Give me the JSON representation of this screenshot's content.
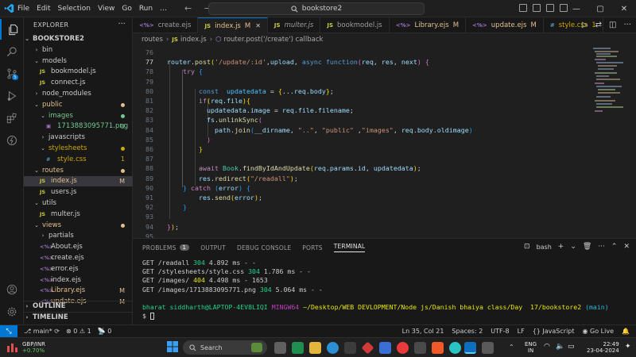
{
  "titlebar": {
    "menu": [
      "File",
      "Edit",
      "Selection",
      "View",
      "Go",
      "Run",
      "…"
    ],
    "nav_arrows": "← →",
    "search_text": "bookstore2"
  },
  "explorer": {
    "title": "EXPLORER",
    "project": "BOOKSTORE2",
    "items": [
      {
        "label": "bin",
        "type": "folder",
        "open": false,
        "indent": 1
      },
      {
        "label": "models",
        "type": "folder",
        "open": true,
        "indent": 1
      },
      {
        "label": "bookmodel.js",
        "type": "js",
        "indent": 2
      },
      {
        "label": "connect.js",
        "type": "js",
        "indent": 2
      },
      {
        "label": "node_modules",
        "type": "folder",
        "open": false,
        "indent": 1
      },
      {
        "label": "public",
        "type": "folder",
        "open": true,
        "indent": 1,
        "color": "#e2c08d",
        "dot": "#e2c08d"
      },
      {
        "label": "images",
        "type": "folder",
        "open": true,
        "indent": 2,
        "color": "#73c991",
        "dot": "#73c991"
      },
      {
        "label": "1713883095771.png",
        "type": "png",
        "indent": 3,
        "color": "#73c991",
        "badge": "U",
        "badge_color": "#73c991"
      },
      {
        "label": "javascripts",
        "type": "folder",
        "open": false,
        "indent": 2
      },
      {
        "label": "stylesheets",
        "type": "folder",
        "open": true,
        "indent": 2,
        "color": "#cca700",
        "dot": "#cca700"
      },
      {
        "label": "style.css",
        "type": "css",
        "indent": 3,
        "color": "#cca700",
        "badge": "1",
        "badge_color": "#cca700"
      },
      {
        "label": "routes",
        "type": "folder",
        "open": true,
        "indent": 1,
        "color": "#e2c08d",
        "dot": "#e2c08d"
      },
      {
        "label": "index.js",
        "type": "js",
        "indent": 2,
        "color": "#e2c08d",
        "badge": "M",
        "badge_color": "#e2c08d",
        "selected": true
      },
      {
        "label": "users.js",
        "type": "js",
        "indent": 2
      },
      {
        "label": "utils",
        "type": "folder",
        "open": true,
        "indent": 1
      },
      {
        "label": "multer.js",
        "type": "js",
        "indent": 2
      },
      {
        "label": "views",
        "type": "folder",
        "open": true,
        "indent": 1,
        "color": "#e2c08d",
        "dot": "#e2c08d"
      },
      {
        "label": "partials",
        "type": "folder",
        "open": false,
        "indent": 2
      },
      {
        "label": "About.ejs",
        "type": "ejs",
        "indent": 2
      },
      {
        "label": "create.ejs",
        "type": "ejs",
        "indent": 2
      },
      {
        "label": "error.ejs",
        "type": "ejs",
        "indent": 2
      },
      {
        "label": "index.ejs",
        "type": "ejs",
        "indent": 2
      },
      {
        "label": "Library.ejs",
        "type": "ejs",
        "indent": 2,
        "color": "#e2c08d",
        "badge": "M",
        "badge_color": "#e2c08d"
      },
      {
        "label": "update.ejs",
        "type": "ejs",
        "indent": 2,
        "color": "#e2c08d",
        "badge": "M",
        "badge_color": "#e2c08d"
      }
    ],
    "outline": "OUTLINE",
    "timeline": "TIMELINE"
  },
  "tabs": [
    {
      "label": "create.ejs",
      "icon": "ejs",
      "active": false,
      "italic": false
    },
    {
      "label": "index.js",
      "suffix": "M",
      "icon": "js",
      "active": true,
      "italic": false,
      "color": "#e2c08d"
    },
    {
      "label": "multer.js",
      "icon": "js",
      "active": false,
      "italic": true
    },
    {
      "label": "bookmodel.js",
      "icon": "js",
      "active": false,
      "italic": false
    },
    {
      "label": "Library.ejs",
      "suffix": "M",
      "icon": "ejs",
      "active": false,
      "italic": false,
      "color": "#e2c08d"
    },
    {
      "label": "update.ejs",
      "suffix": "M",
      "icon": "ejs",
      "active": false,
      "italic": false,
      "color": "#e2c08d"
    },
    {
      "label": "style.css",
      "suffix": "1",
      "icon": "css",
      "active": false,
      "italic": false,
      "color": "#cca700"
    }
  ],
  "breadcrumb": [
    "routes",
    "index.js",
    "router.post('/create') callback"
  ],
  "code_lines": [
    {
      "num": "76",
      "tokens": [
        [
          "",
          ""
        ]
      ]
    },
    {
      "num": "77",
      "tokens": [
        [
          "var",
          "router"
        ],
        [
          "def",
          "."
        ],
        [
          "fn",
          "post"
        ],
        [
          "br1",
          "("
        ],
        [
          "str",
          "'/update/:id'"
        ],
        [
          "def",
          ","
        ],
        [
          "var",
          "upload"
        ],
        [
          "def",
          ", "
        ],
        [
          "kw",
          "async"
        ],
        [
          "def",
          " "
        ],
        [
          "kw",
          "function"
        ],
        [
          "br2",
          "("
        ],
        [
          "var",
          "req"
        ],
        [
          "def",
          ", "
        ],
        [
          "var",
          "res"
        ],
        [
          "def",
          ", "
        ],
        [
          "var",
          "next"
        ],
        [
          "br2",
          ")"
        ],
        [
          "def",
          " "
        ],
        [
          "br2",
          "{"
        ]
      ]
    },
    {
      "num": "78",
      "tokens": [
        [
          "def",
          "    "
        ],
        [
          "ctl",
          "try"
        ],
        [
          "def",
          " "
        ],
        [
          "br3",
          "{"
        ]
      ]
    },
    {
      "num": "79",
      "tokens": [
        [
          "",
          ""
        ]
      ]
    },
    {
      "num": "80",
      "tokens": [
        [
          "def",
          "        "
        ],
        [
          "kw",
          "const"
        ],
        [
          "def",
          "  "
        ],
        [
          "const",
          "updatedata"
        ],
        [
          "def",
          " = "
        ],
        [
          "br1",
          "{"
        ],
        [
          "def",
          "..."
        ],
        [
          "var",
          "req"
        ],
        [
          "def",
          "."
        ],
        [
          "var",
          "body"
        ],
        [
          "br1",
          "}"
        ],
        [
          "def",
          ";"
        ]
      ]
    },
    {
      "num": "81",
      "tokens": [
        [
          "def",
          "        "
        ],
        [
          "ctl",
          "if"
        ],
        [
          "br1",
          "("
        ],
        [
          "var",
          "req"
        ],
        [
          "def",
          "."
        ],
        [
          "var",
          "file"
        ],
        [
          "br1",
          ")"
        ],
        [
          "br1",
          "{"
        ]
      ]
    },
    {
      "num": "82",
      "tokens": [
        [
          "def",
          "          "
        ],
        [
          "var",
          "updatedata"
        ],
        [
          "def",
          "."
        ],
        [
          "var",
          "image"
        ],
        [
          "def",
          " = "
        ],
        [
          "var",
          "req"
        ],
        [
          "def",
          "."
        ],
        [
          "var",
          "file"
        ],
        [
          "def",
          "."
        ],
        [
          "var",
          "filename"
        ],
        [
          "def",
          ";"
        ]
      ]
    },
    {
      "num": "83",
      "tokens": [
        [
          "def",
          "          "
        ],
        [
          "var",
          "fs"
        ],
        [
          "def",
          "."
        ],
        [
          "fn",
          "unlinkSync"
        ],
        [
          "br2",
          "("
        ]
      ]
    },
    {
      "num": "84",
      "tokens": [
        [
          "def",
          "            "
        ],
        [
          "var",
          "path"
        ],
        [
          "def",
          "."
        ],
        [
          "fn",
          "join"
        ],
        [
          "br3",
          "("
        ],
        [
          "var",
          "__dirname"
        ],
        [
          "def",
          ", "
        ],
        [
          "str",
          "\"..\""
        ],
        [
          "def",
          ", "
        ],
        [
          "str",
          "\"public\""
        ],
        [
          "def",
          " ,"
        ],
        [
          "str",
          "\"images\""
        ],
        [
          "def",
          ", "
        ],
        [
          "var",
          "req"
        ],
        [
          "def",
          "."
        ],
        [
          "var",
          "body"
        ],
        [
          "def",
          "."
        ],
        [
          "var",
          "oldimage"
        ],
        [
          "br3",
          ")"
        ]
      ]
    },
    {
      "num": "85",
      "tokens": [
        [
          "def",
          "          "
        ],
        [
          "br2",
          ")"
        ]
      ]
    },
    {
      "num": "86",
      "tokens": [
        [
          "def",
          "        "
        ],
        [
          "br1",
          "}"
        ]
      ]
    },
    {
      "num": "87",
      "tokens": [
        [
          "",
          ""
        ]
      ]
    },
    {
      "num": "88",
      "tokens": [
        [
          "def",
          "        "
        ],
        [
          "ctl",
          "await"
        ],
        [
          "def",
          " "
        ],
        [
          "cls",
          "Book"
        ],
        [
          "def",
          "."
        ],
        [
          "fn",
          "findByIdAndUpdate"
        ],
        [
          "br1",
          "("
        ],
        [
          "var",
          "req"
        ],
        [
          "def",
          "."
        ],
        [
          "var",
          "params"
        ],
        [
          "def",
          "."
        ],
        [
          "var",
          "id"
        ],
        [
          "def",
          ", "
        ],
        [
          "var",
          "updatedata"
        ],
        [
          "br1",
          ")"
        ],
        [
          "def",
          ";"
        ]
      ]
    },
    {
      "num": "89",
      "tokens": [
        [
          "def",
          "        "
        ],
        [
          "var",
          "res"
        ],
        [
          "def",
          "."
        ],
        [
          "fn",
          "redirect"
        ],
        [
          "br1",
          "("
        ],
        [
          "str",
          "\"/readall\""
        ],
        [
          "br1",
          ")"
        ],
        [
          "def",
          ";"
        ]
      ]
    },
    {
      "num": "90",
      "tokens": [
        [
          "def",
          "    "
        ],
        [
          "br3",
          "}"
        ],
        [
          "def",
          " "
        ],
        [
          "ctl",
          "catch"
        ],
        [
          "def",
          " "
        ],
        [
          "br3",
          "("
        ],
        [
          "var",
          "error"
        ],
        [
          "br3",
          ")"
        ],
        [
          "def",
          " "
        ],
        [
          "br3",
          "{"
        ]
      ]
    },
    {
      "num": "91",
      "tokens": [
        [
          "def",
          "        "
        ],
        [
          "var",
          "res"
        ],
        [
          "def",
          "."
        ],
        [
          "fn",
          "send"
        ],
        [
          "br1",
          "("
        ],
        [
          "var",
          "error"
        ],
        [
          "br1",
          ")"
        ],
        [
          "def",
          ";"
        ]
      ]
    },
    {
      "num": "92",
      "tokens": [
        [
          "def",
          "    "
        ],
        [
          "br3",
          "}"
        ]
      ]
    },
    {
      "num": "93",
      "tokens": [
        [
          "",
          ""
        ]
      ]
    },
    {
      "num": "94",
      "tokens": [
        [
          "br2",
          "}"
        ],
        [
          "br1",
          ")"
        ],
        [
          "def",
          ";"
        ]
      ]
    },
    {
      "num": "95",
      "tokens": [
        [
          "",
          ""
        ]
      ]
    }
  ],
  "panel": {
    "tabs": [
      {
        "label": "PROBLEMS",
        "count": "1"
      },
      {
        "label": "OUTPUT"
      },
      {
        "label": "DEBUG CONSOLE"
      },
      {
        "label": "PORTS"
      },
      {
        "label": "TERMINAL",
        "active": true
      }
    ],
    "shell": "bash",
    "terminal_lines": [
      [
        [
          "def",
          "GET /readall "
        ],
        [
          "grn",
          "304"
        ],
        [
          "def",
          " 4.892 ms - -"
        ]
      ],
      [
        [
          "def",
          "GET /stylesheets/style.css "
        ],
        [
          "grn",
          "304"
        ],
        [
          "def",
          " 1.786 ms - -"
        ]
      ],
      [
        [
          "def",
          "GET /images/ "
        ],
        [
          "ylw",
          "404"
        ],
        [
          "def",
          " 4.498 ms - 1653"
        ]
      ],
      [
        [
          "def",
          "GET /images/1713883095771.png "
        ],
        [
          "grn",
          "304"
        ],
        [
          "def",
          " 5.064 ms - -"
        ]
      ],
      [
        [
          "",
          ""
        ]
      ],
      [
        [
          "grn",
          "bharat siddharth@LAPTOP-4EV8LIQI"
        ],
        [
          "def",
          " "
        ],
        [
          "mag",
          "MINGW64"
        ],
        [
          "def",
          " "
        ],
        [
          "ylw",
          "~/Desktop/WEB DEVLOPMENT/Node js/Danish bhaiya class/Day  17/bookstore2"
        ],
        [
          "def",
          " "
        ],
        [
          "cyn",
          "(main)"
        ]
      ],
      [
        [
          "def",
          "$ "
        ]
      ]
    ]
  },
  "status": {
    "branch": "main*",
    "errors": "0",
    "warnings": "1",
    "ports": "0",
    "position": "Ln 35, Col 21",
    "spaces": "Spaces: 2",
    "encoding": "UTF-8",
    "eol": "LF",
    "language": "{} JavaScript",
    "golive": "Go Live"
  },
  "taskbar": {
    "ticker": "GBP/INR",
    "ticker_change": "+0.70%",
    "search": "Search",
    "lang": "ENG",
    "region": "IN",
    "time": "22:49",
    "date": "23-04-2024"
  }
}
